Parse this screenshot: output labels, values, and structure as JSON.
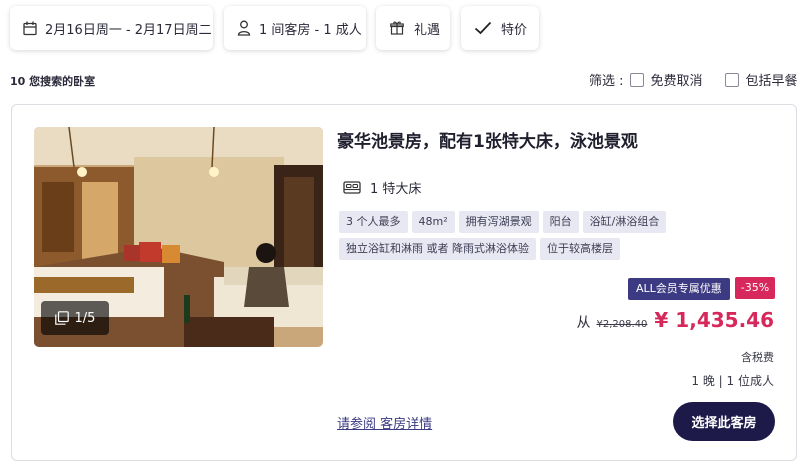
{
  "search_chips": {
    "dates": "2月16日周一 - 2月17日周二",
    "guests": "1 间客房 - 1 成人",
    "offers": "礼遇",
    "deals": "特价"
  },
  "results_count": "10 您搜索的卧室",
  "filters": {
    "label": "筛选 :",
    "options": [
      "免费取消",
      "包括早餐"
    ]
  },
  "room": {
    "title": "豪华池景房，配有1张特大床，泳池景观",
    "bed": "1 特大床",
    "tags": [
      "3 个人最多",
      "48m²",
      "拥有泻湖景观",
      "阳台",
      "浴缸/淋浴组合",
      "独立浴缸和淋雨 或者 降雨式淋浴体验",
      "位于较高楼层"
    ],
    "photo_counter": "1/5",
    "member_badge": "ALL会员专属优惠",
    "discount": "-35%",
    "price_from": "从",
    "price_old": "¥2,208.40",
    "price_new": "¥ 1,435.46",
    "tax_note": "含税费",
    "stay_info": "1 晚 | 1 位成人",
    "details_link": "请参阅 客房详情",
    "select_button": "选择此客房"
  },
  "colors": {
    "accent": "#d6285a",
    "member": "#3b3a82",
    "button": "#1d1a4a",
    "tag_bg": "#e8e8f2"
  }
}
